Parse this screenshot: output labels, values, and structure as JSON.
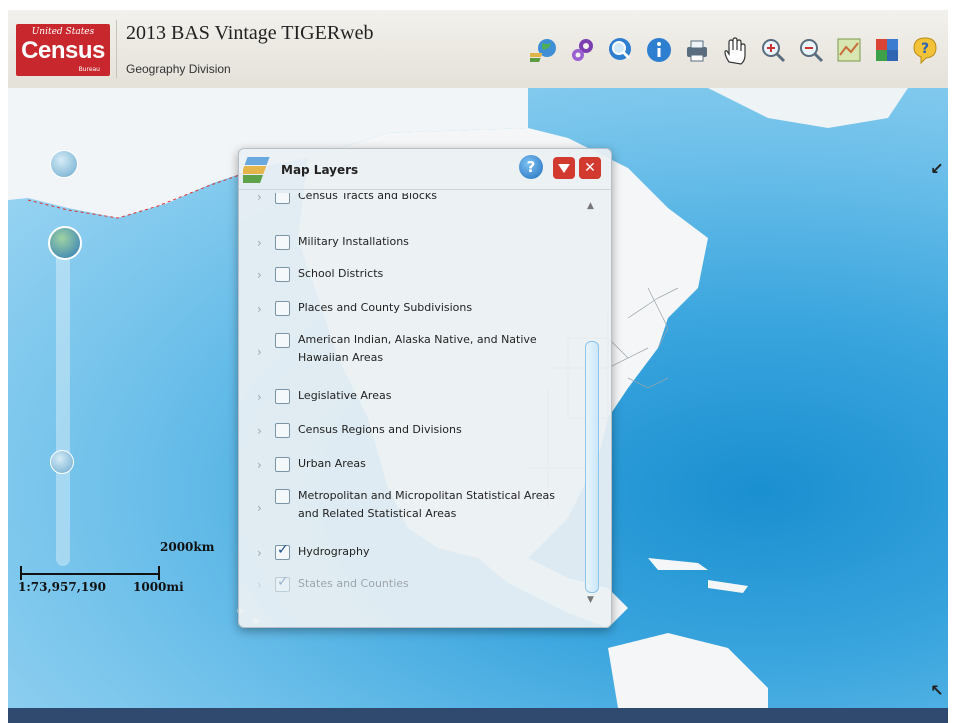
{
  "header": {
    "logo_top": "United States",
    "logo_main": "Census",
    "logo_bottom": "Bureau",
    "title": "2013 BAS Vintage TIGERweb",
    "subtitle": "Geography Division"
  },
  "toolbar": {
    "icons": [
      "layers-globe-icon",
      "tools-gears-icon",
      "search-icon",
      "info-icon",
      "print-icon",
      "pan-hand-icon",
      "zoom-in-icon",
      "zoom-out-icon",
      "basemap-icon",
      "puzzle-icon",
      "help-icon"
    ]
  },
  "map": {
    "scale_km": "2000km",
    "scale_ratio": "1:73,957,190",
    "scale_mi": "1000mi",
    "corner_top": "↙",
    "corner_bottom": "↖"
  },
  "layers_panel": {
    "title": "Map Layers",
    "help_label": "?",
    "close_label": "✕",
    "items": [
      {
        "label": "Census Tracts and Blocks",
        "checked": false
      },
      {
        "label": "Military Installations",
        "checked": false
      },
      {
        "label": "School Districts",
        "checked": false
      },
      {
        "label": "Places and County Subdivisions",
        "checked": false
      },
      {
        "label": "American Indian, Alaska Native, and Native Hawaiian Areas",
        "checked": false
      },
      {
        "label": "Legislative Areas",
        "checked": false
      },
      {
        "label": "Census Regions and Divisions",
        "checked": false
      },
      {
        "label": "Urban Areas",
        "checked": false
      },
      {
        "label": "Metropolitan and Micropolitan Statistical Areas and Related Statistical Areas",
        "checked": false
      },
      {
        "label": "Hydrography",
        "checked": true
      },
      {
        "label": "States and Counties",
        "checked": true
      }
    ]
  },
  "colors": {
    "census_red": "#c8282d",
    "ocean": "#3aa5de",
    "land": "#f4f6f7"
  }
}
